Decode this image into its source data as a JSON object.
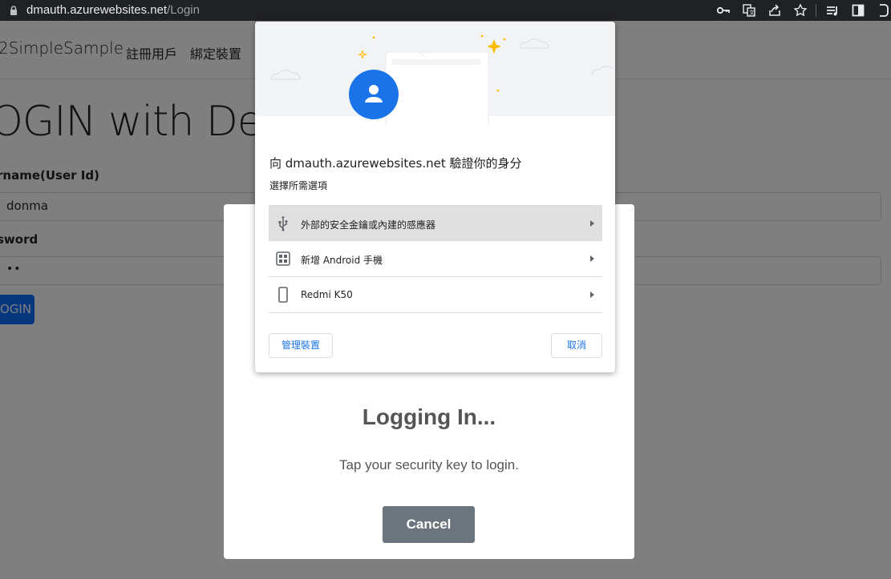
{
  "browser": {
    "url_host": "dmauth.azurewebsites.net",
    "url_path": "/Login",
    "icons": [
      "lock-icon",
      "key-icon",
      "translate-icon",
      "share-icon",
      "star-icon",
      "reading-list-icon",
      "side-panel-icon",
      "profile-icon"
    ]
  },
  "site": {
    "brand": "2SimpleSample",
    "nav": [
      "註冊用戶",
      "綁定裝置"
    ],
    "heading": "OGIN with De",
    "username_label": "rname(User Id)",
    "username_value": "donma",
    "password_label": "sword",
    "password_value": "••",
    "login_button": "OGIN"
  },
  "site_modal": {
    "title": "Logging In...",
    "message": "Tap your security key to login.",
    "cancel": "Cancel"
  },
  "auth_dialog": {
    "heading": "向 dmauth.azurewebsites.net 驗證你的身分",
    "subheading": "選擇所需選項",
    "options": [
      {
        "label": "外部的安全金鑰或內建的感應器",
        "icon": "usb-icon"
      },
      {
        "label": "新增 Android 手機",
        "icon": "qr-code-icon"
      },
      {
        "label": "Redmi K50",
        "icon": "phone-icon"
      }
    ],
    "manage_button": "管理裝置",
    "cancel_button": "取消"
  },
  "colors": {
    "accent_blue": "#1a73e8",
    "primary_button": "#0d6efd",
    "secondary_button": "#6c757d"
  }
}
